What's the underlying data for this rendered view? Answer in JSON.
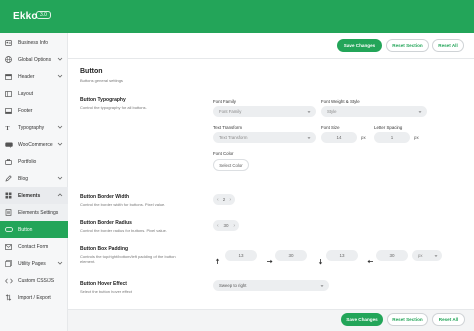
{
  "app": {
    "brand": "Ekko",
    "version": "3.0"
  },
  "sidebar": {
    "items": [
      {
        "label": "Business Info",
        "icon": "id-card-icon",
        "chevron": false
      },
      {
        "label": "Global Options",
        "icon": "globe-icon",
        "chevron": true
      },
      {
        "label": "Header",
        "icon": "header-icon",
        "chevron": true
      },
      {
        "label": "Layout",
        "icon": "layout-icon",
        "chevron": false
      },
      {
        "label": "Footer",
        "icon": "footer-icon",
        "chevron": false
      },
      {
        "label": "Typography",
        "icon": "typography-icon",
        "chevron": true
      },
      {
        "label": "WooCommerce",
        "icon": "woocommerce-icon",
        "chevron": true
      },
      {
        "label": "Portfolio",
        "icon": "portfolio-icon",
        "chevron": false
      },
      {
        "label": "Blog",
        "icon": "blog-icon",
        "chevron": true
      },
      {
        "label": "Elements",
        "icon": "elements-icon",
        "chevron": true
      },
      {
        "label": "Elements Settings",
        "icon": "elements-settings-icon",
        "chevron": false
      },
      {
        "label": "Button",
        "icon": "button-icon",
        "chevron": false
      },
      {
        "label": "Contact Form",
        "icon": "contact-form-icon",
        "chevron": false
      },
      {
        "label": "Utility Pages",
        "icon": "utility-pages-icon",
        "chevron": true
      },
      {
        "label": "Custom CSS/JS",
        "icon": "code-icon",
        "chevron": false
      },
      {
        "label": "Import / Export",
        "icon": "import-export-icon",
        "chevron": false
      }
    ]
  },
  "actions": {
    "save": "Save Changes",
    "reset_section": "Reset Section",
    "reset_all": "Reset All"
  },
  "section": {
    "title": "Button",
    "description": "Buttons general settings"
  },
  "typography": {
    "label": "Button Typography",
    "desc": "Control the typography for all buttons.",
    "font_family_label": "Font Family",
    "font_family_value": "Font Family",
    "font_weight_label": "Font Weight & Style",
    "font_weight_value": "Style",
    "text_transform_label": "Text Transform",
    "text_transform_value": "Text Transform",
    "font_size_label": "Font Size",
    "font_size_value": "14",
    "font_size_unit": "px",
    "letter_spacing_label": "Letter Spacing",
    "letter_spacing_value": "1",
    "letter_spacing_unit": "px",
    "font_color_label": "Font Color",
    "select_color": "Select Color"
  },
  "border_width": {
    "label": "Button Border Width",
    "desc": "Control the border width for buttons. Pixel value.",
    "value": "2"
  },
  "border_radius": {
    "label": "Button Border Radius",
    "desc": "Control the border radius for buttons. Pixel value.",
    "value": "30"
  },
  "padding": {
    "label": "Button Box Padding",
    "desc": "Controls the top/right/bottom/left padding of the button element.",
    "top": "13",
    "right": "30",
    "bottom": "13",
    "left": "30",
    "unit": "px"
  },
  "hover": {
    "label": "Button Hover Effect",
    "desc": "Select the button hover effect",
    "value": "Sweep to right"
  },
  "colors": {
    "accent": "#23a559",
    "sidebar_bg": "#f6f7f8",
    "field_bg": "#eceef0"
  }
}
